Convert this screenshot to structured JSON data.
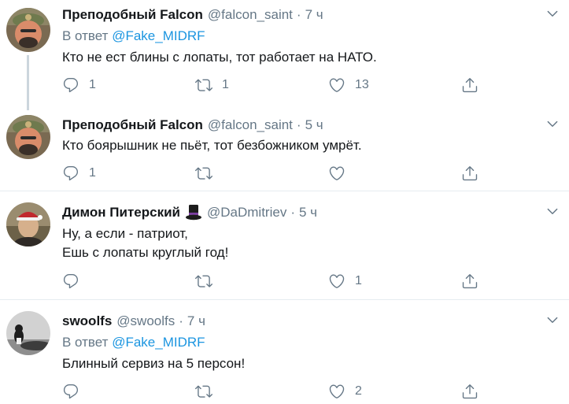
{
  "colors": {
    "name": "#14171a",
    "muted": "#657786",
    "link": "#1b95e0",
    "divider": "#e6ecf0",
    "thread_line": "#ccd6dd"
  },
  "tweets": [
    {
      "name": "Преподобный Falcon",
      "handle": "@falcon_saint",
      "dot": "·",
      "time": "7 ч",
      "reply_prefix": "В ответ",
      "reply_to": "@Fake_MIDRF",
      "lines": [
        "Кто не ест блины с лопаты, тот работает на НАТО."
      ],
      "replies": "1",
      "retweets": "1",
      "likes": "13",
      "icons": [
        "avatar",
        "chevron-down-icon",
        "reply-icon",
        "retweet-icon",
        "like-icon",
        "share-icon"
      ]
    },
    {
      "name": "Преподобный Falcon",
      "handle": "@falcon_saint",
      "dot": "·",
      "time": "5 ч",
      "lines": [
        "Кто боярышник не пьёт, тот безбожником умрёт."
      ],
      "replies": "1",
      "retweets": "",
      "likes": ""
    },
    {
      "name": "Димон Питерский",
      "name_emoji": "top-hat-icon",
      "handle": "@DaDmitriev",
      "dot": "·",
      "time": "5 ч",
      "lines": [
        "Ну, а если - патриот,",
        "Ешь с лопаты круглый год!"
      ],
      "replies": "",
      "retweets": "",
      "likes": "1"
    },
    {
      "name": "swoolfs",
      "handle": "@swoolfs",
      "dot": "·",
      "time": "7 ч",
      "reply_prefix": "В ответ",
      "reply_to": "@Fake_MIDRF",
      "lines": [
        "Блинный сервиз на 5 персон!"
      ],
      "replies": "",
      "retweets": "",
      "likes": "2"
    }
  ]
}
